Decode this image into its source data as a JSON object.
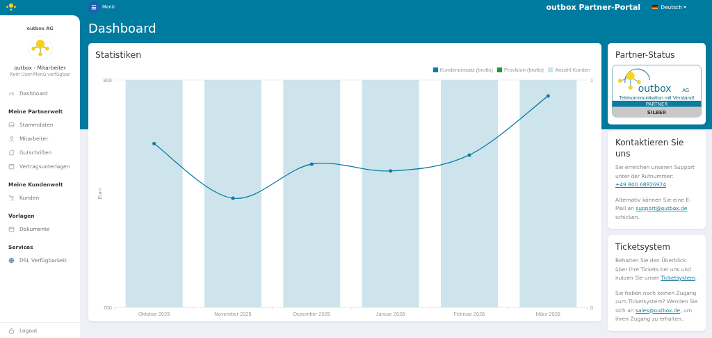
{
  "topbar": {
    "menu_label": "Menü",
    "portal_title": "outbox Partner-Portal",
    "language": "Deutsch"
  },
  "sidebar": {
    "company": "outbox AG",
    "user_name": "outbox - Mitarbeiter",
    "user_note": "Kein User-Menü verfügbar",
    "sections": [
      {
        "items": [
          {
            "label": "Dashboard",
            "kind": "gauge"
          }
        ]
      },
      {
        "heading": "Meine Partnerwelt",
        "items": [
          {
            "label": "Stammdaten",
            "kind": "tray"
          },
          {
            "label": "Mitarbeiter",
            "kind": "person"
          },
          {
            "label": "Gutschriften",
            "kind": "document"
          },
          {
            "label": "Vertragsunterlagen",
            "kind": "folder"
          }
        ]
      },
      {
        "heading": "Meine Kundenwelt",
        "items": [
          {
            "label": "Kunden",
            "kind": "people"
          }
        ]
      },
      {
        "heading": "Vorlagen",
        "items": [
          {
            "label": "Dokumente",
            "kind": "folder"
          }
        ]
      },
      {
        "heading": "Services",
        "items": [
          {
            "label": "DSL Verfügbarkeit",
            "kind": "globe"
          }
        ]
      }
    ],
    "logout": "Logout"
  },
  "page_title": "Dashboard",
  "statistics": {
    "title": "Statistiken",
    "chart_data": {
      "type": "bar",
      "ylabel": "Euro",
      "legend": "top-right",
      "categories": [
        "Oktober 2025",
        "November 2025",
        "Dezember 2025",
        "Januar 2026",
        "Februar 2026",
        "März 2026"
      ],
      "ylim": [
        700,
        800
      ],
      "yticks": [
        700,
        800
      ],
      "y2lim": [
        0,
        1
      ],
      "y2ticks": [
        0,
        1
      ],
      "series": [
        {
          "name": "Kundenumsatz (brutto)",
          "color": "#0a7ea4",
          "type": "line",
          "values": [
            772,
            748,
            763,
            760,
            767,
            793
          ]
        },
        {
          "name": "Provision (brutto)",
          "color": "#1a9e2e",
          "type": "line",
          "values": [
            null,
            null,
            null,
            null,
            null,
            null
          ]
        },
        {
          "name": "Anzahl Kunden",
          "color": "#cde4ec",
          "type": "bar",
          "axis": "y2",
          "values": [
            1,
            1,
            1,
            1,
            1,
            1
          ]
        }
      ]
    }
  },
  "partner_status": {
    "title": "Partner-Status",
    "badge": {
      "brand": "outbox",
      "brand_suffix": "AG",
      "tagline": "Telekommunikation mit Verstand!",
      "label": "PARTNER",
      "level": "SILBER"
    }
  },
  "contact": {
    "title": "Kontaktieren Sie uns",
    "paragraphs": [
      [
        {
          "text": "Sie erreichen unseren Support unter der Rufnummer: "
        },
        {
          "link": "+49 800 68826924"
        }
      ],
      [
        {
          "text": "Alternativ können Sie eine E-Mail an "
        },
        {
          "link": "support@outbox.de"
        },
        {
          "text": " schicken."
        }
      ]
    ]
  },
  "tickets": {
    "title": "Ticketsystem",
    "paragraphs": [
      [
        {
          "text": "Behalten Sie den Überblick über ihre Tickets bei uns und nutzen Sie unser "
        },
        {
          "link": "Ticketsystem"
        },
        {
          "text": "."
        }
      ],
      [
        {
          "text": "Sie haben noch keinen Zugang zum Ticketsystem? Wenden Sie sich an "
        },
        {
          "link": "sales@outbox.de"
        },
        {
          "text": ", um ihren Zugang zu erhalten."
        }
      ]
    ]
  }
}
